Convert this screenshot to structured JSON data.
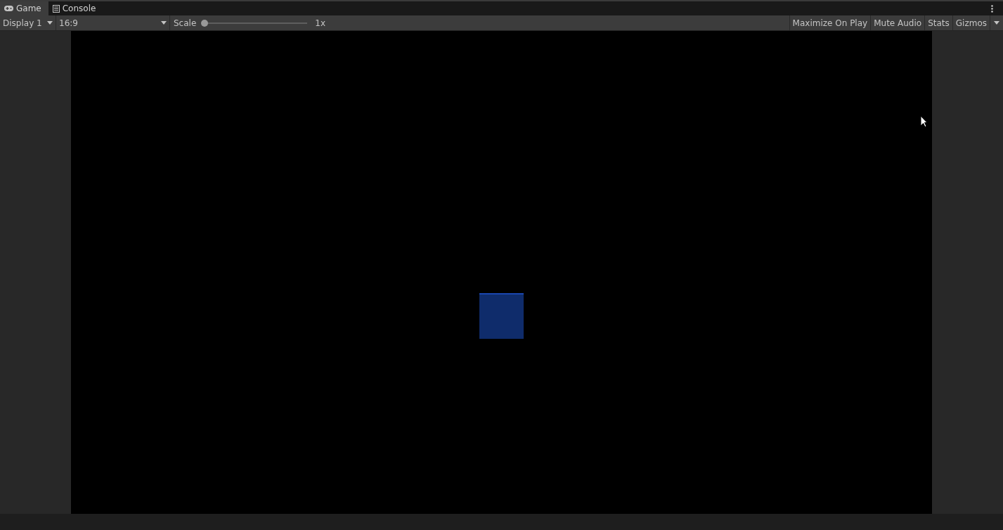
{
  "tabs": [
    {
      "label": "Game",
      "selected": true
    },
    {
      "label": "Console",
      "selected": false
    }
  ],
  "toolbar": {
    "display": "Display 1",
    "aspect": "16:9",
    "scale_label": "Scale",
    "scale": {
      "level": 0
    },
    "scale_reading": "1x",
    "buttons": [
      "Maximize On Play",
      "Mute Audio",
      "Stats",
      "Gizmos"
    ]
  }
}
